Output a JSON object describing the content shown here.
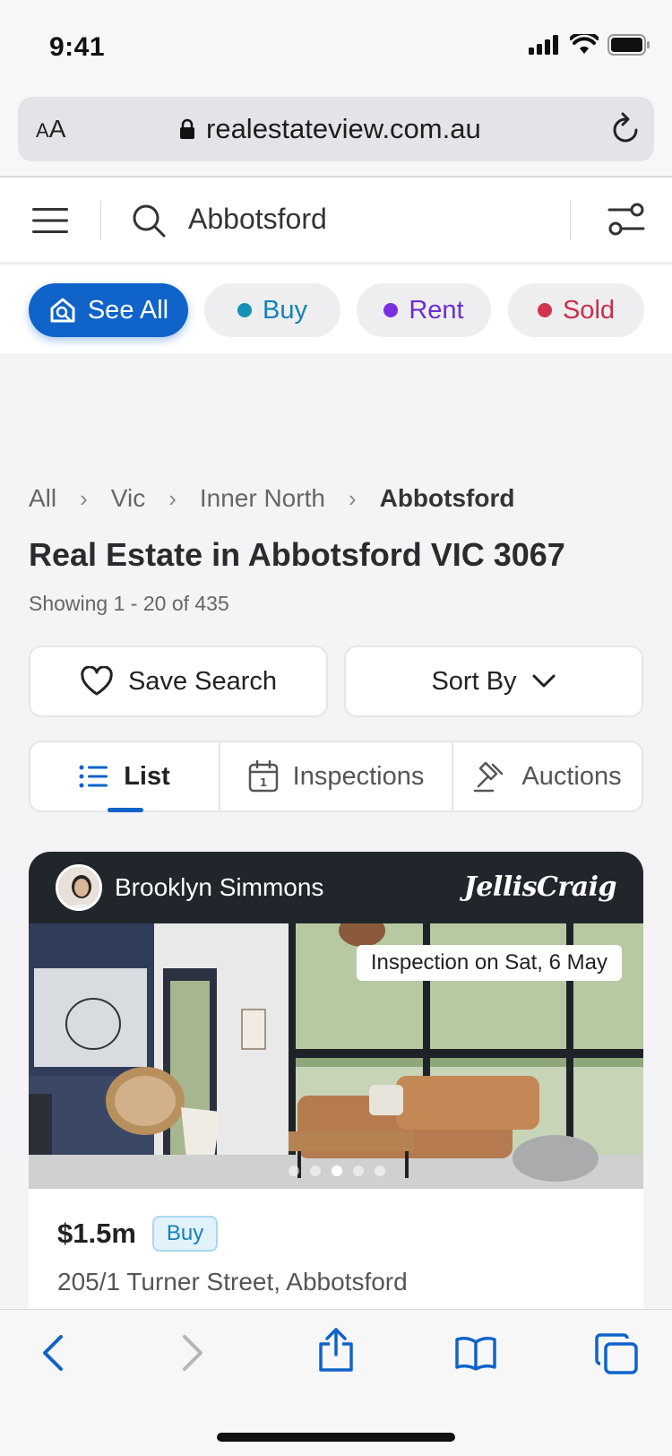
{
  "status": {
    "time": "9:41"
  },
  "browser": {
    "text_size_label_small": "A",
    "text_size_label_large": "A",
    "url": "realestateview.com.au"
  },
  "header": {
    "search_value": "Abbotsford"
  },
  "chips": [
    {
      "label": "See All",
      "active": true
    },
    {
      "label": "Buy",
      "dot_color": "#1591b5",
      "text_color": "#1582b8"
    },
    {
      "label": "Rent",
      "dot_color": "#7a2fe0",
      "text_color": "#6b2fd0"
    },
    {
      "label": "Sold",
      "dot_color": "#d2344f",
      "text_color": "#c8304a"
    }
  ],
  "breadcrumb": [
    "All",
    "Vic",
    "Inner North",
    "Abbotsford"
  ],
  "page": {
    "title": "Real Estate in Abbotsford VIC 3067",
    "showing": "Showing 1 - 20 of 435"
  },
  "actions": {
    "save_search": "Save Search",
    "sort_by": "Sort By"
  },
  "view_tabs": [
    "List",
    "Inspections",
    "Auctions"
  ],
  "listing": {
    "agent_name": "Brooklyn Simmons",
    "agency": "JellisCraig",
    "inspection": "Inspection on Sat, 6 May",
    "price": "$1.5m",
    "type": "Buy",
    "address": "205/1 Turner Street, Abbotsford",
    "photo_index": 3,
    "photo_count": 5
  },
  "colors": {
    "accent": "#0f63c9",
    "dark_header": "#21262d"
  }
}
